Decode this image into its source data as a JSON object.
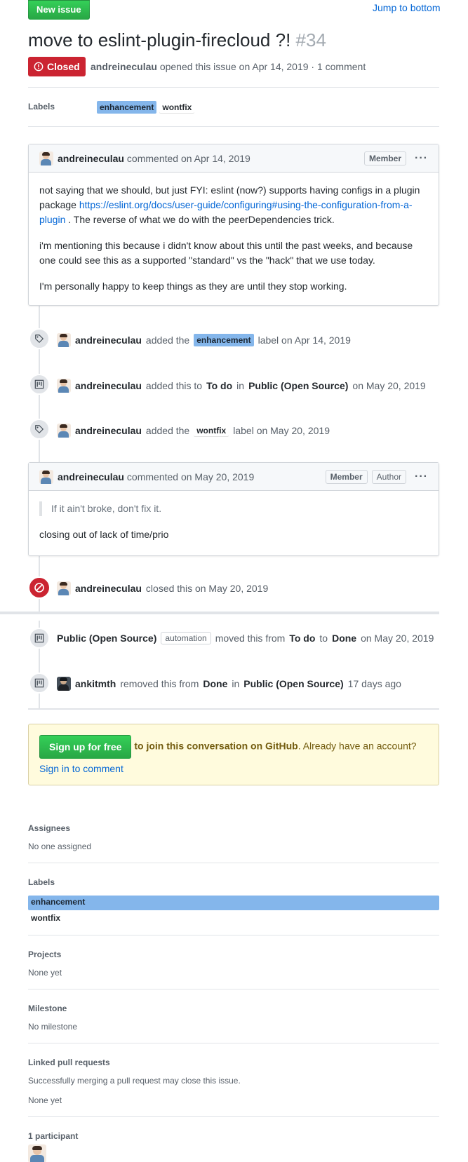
{
  "top": {
    "new_issue": "New issue",
    "jump": "Jump to bottom"
  },
  "issue": {
    "title": "move to eslint-plugin-firecloud ?!",
    "number": "#34",
    "state": "Closed",
    "author": "andreineculau",
    "opened_text": "opened this issue on Apr 14, 2019 · 1 comment"
  },
  "labels_row": {
    "heading": "Labels",
    "items": [
      "enhancement",
      "wontfix"
    ]
  },
  "comment1": {
    "author": "andreineculau",
    "action": "commented on Apr 14, 2019",
    "role": "Member",
    "p1_a": "not saying that we should, but just FYI: eslint (now?) supports having configs in a plugin package ",
    "p1_link": "https://eslint.org/docs/user-guide/configuring#using-the-configuration-from-a-plugin",
    "p1_b": " . The reverse of what we do with the peerDependencies trick.",
    "p2": "i'm mentioning this because i didn't know about this until the past weeks, and because one could see this as a supported \"standard\" vs the \"hack\" that we use today.",
    "p3": "I'm personally happy to keep things as they are until they stop working."
  },
  "events": {
    "e1": {
      "actor": "andreineculau",
      "pre": "added the",
      "label": "enhancement",
      "post": "label on Apr 14, 2019"
    },
    "e2": {
      "actor": "andreineculau",
      "pre": "added this to",
      "column": "To do",
      "in": "in",
      "project": "Public (Open Source)",
      "date": "on May 20, 2019"
    },
    "e3": {
      "actor": "andreineculau",
      "pre": "added the",
      "label": "wontfix",
      "post": "label on May 20, 2019"
    },
    "e4": {
      "actor": "andreineculau",
      "text": "closed this on May 20, 2019"
    },
    "e5": {
      "actor": "Public (Open Source)",
      "badge": "automation",
      "pre": "moved this from",
      "from": "To do",
      "to_word": "to",
      "to": "Done",
      "date": "on May 20, 2019"
    },
    "e6": {
      "actor": "ankitmth",
      "pre": "removed this from",
      "from": "Done",
      "in": "in",
      "project": "Public (Open Source)",
      "date": "17 days ago"
    }
  },
  "comment2": {
    "author": "andreineculau",
    "action": "commented on May 20, 2019",
    "role1": "Member",
    "role2": "Author",
    "quote": "If it ain't broke, don't fix it.",
    "body": "closing out of lack of time/prio"
  },
  "signup": {
    "button": "Sign up for free",
    "bold": "to join this conversation on GitHub",
    "middle": ". Already have an account?",
    "link": "Sign in to comment"
  },
  "sidebar": {
    "assignees_h": "Assignees",
    "assignees_v": "No one assigned",
    "labels_h": "Labels",
    "labels": [
      "enhancement",
      "wontfix"
    ],
    "projects_h": "Projects",
    "projects_v": "None yet",
    "milestone_h": "Milestone",
    "milestone_v": "No milestone",
    "linked_h": "Linked pull requests",
    "linked_note": "Successfully merging a pull request may close this issue.",
    "linked_v": "None yet",
    "participants_h": "1 participant"
  },
  "colors": {
    "closed": "#cb2431",
    "enhancement": "#84b6eb",
    "green": "#2ea44f",
    "link": "#0366d6"
  }
}
